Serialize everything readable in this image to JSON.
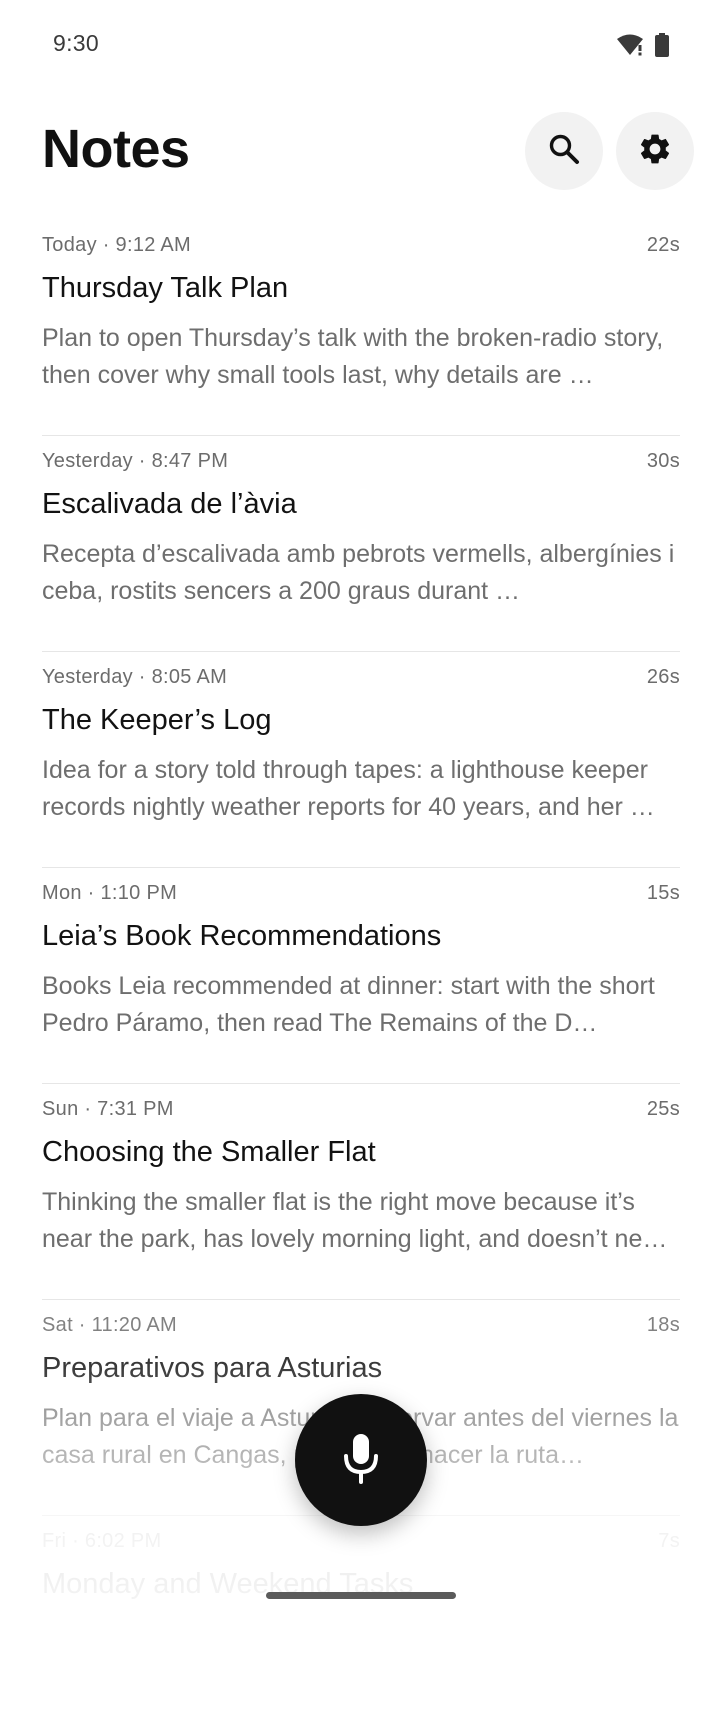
{
  "status_bar": {
    "time": "9:30"
  },
  "header": {
    "title": "Notes",
    "icons": {
      "search": "search-icon",
      "settings": "gear-icon"
    }
  },
  "notes": [
    {
      "meta": "Today · 9:12 AM",
      "duration": "22s",
      "title": "Thursday Talk Plan",
      "preview": "Plan to open Thursday’s talk with the broken-radio story, then cover why small tools last, why details are …"
    },
    {
      "meta": "Yesterday · 8:47 PM",
      "duration": "30s",
      "title": "Escalivada de l’àvia",
      "preview": "Recepta d’escalivada amb pebrots vermells, albergínies i ceba, rostits sencers a 200 graus durant …"
    },
    {
      "meta": "Yesterday · 8:05 AM",
      "duration": "26s",
      "title": "The Keeper’s Log",
      "preview": "Idea for a story told through tapes: a lighthouse keeper records nightly weather reports for 40 years, and her …"
    },
    {
      "meta": "Mon · 1:10 PM",
      "duration": "15s",
      "title": "Leia’s Book Recommendations",
      "preview": "Books Leia recommended at dinner: start with the short Pedro Páramo, then read The Remains of the D…"
    },
    {
      "meta": "Sun · 7:31 PM",
      "duration": "25s",
      "title": "Choosing the Smaller Flat",
      "preview": "Thinking the smaller flat is the right move because it’s near the park, has lovely morning light, and doesn’t ne…"
    },
    {
      "meta": "Sat · 11:20 AM",
      "duration": "18s",
      "title": "Preparativos para Asturias",
      "preview": "Plan para el viaje a Asturias: reservar antes del viernes la casa rural en Cangas, punto para hacer la ruta…"
    },
    {
      "meta": "Fri · 6:02 PM",
      "duration": "7s",
      "title": "Monday and Weekend Tasks",
      "preview": ""
    }
  ],
  "fab": {
    "icon": "microphone-icon"
  },
  "colors": {
    "background": "#ffffff",
    "title": "#111111",
    "secondary_text": "#6e6e6e",
    "fab": "#111111",
    "icon_button_bg": "#f2f2f2",
    "divider": "#e6e6e6"
  }
}
